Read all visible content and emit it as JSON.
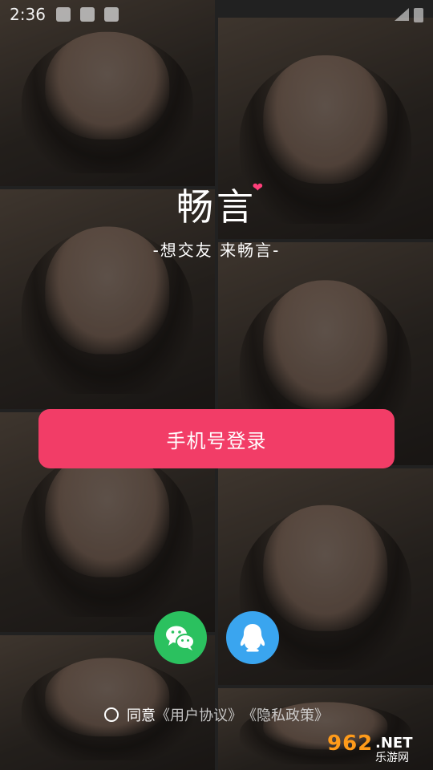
{
  "status_bar": {
    "time": "2:36"
  },
  "brand": {
    "name": "畅言",
    "slogan": "-想交友 来畅言-"
  },
  "login": {
    "phone_label": "手机号登录"
  },
  "social": {
    "wechat": "wechat-icon",
    "qq": "qq-icon"
  },
  "agreement": {
    "prefix": "同意",
    "user_agreement": "《用户协议》",
    "privacy_policy": "《隐私政策》"
  },
  "watermark": {
    "num": "962",
    "net": ".NET",
    "cn": "乐游网"
  },
  "colors": {
    "primary": "#f23d67",
    "wechat": "#2bc15f",
    "qq": "#3aa5ef",
    "heart": "#ff3f7a"
  }
}
